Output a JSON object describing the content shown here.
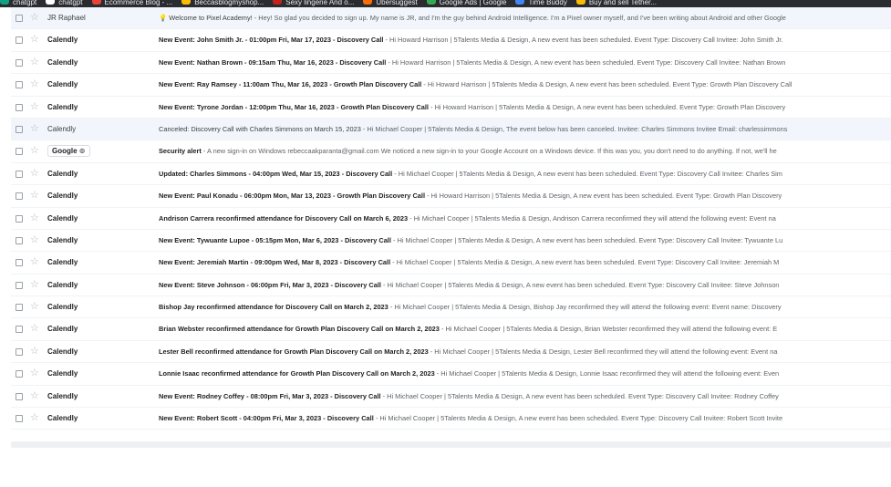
{
  "bookmarks": [
    {
      "label": "chatgpt",
      "icon": "chatgpt-icon",
      "color": "#10a37f"
    },
    {
      "label": "chatgpt",
      "icon": "chatgpt-icon",
      "color": "#ffffff"
    },
    {
      "label": "Ecommerce Blog - ...",
      "icon": "ecommerce-icon",
      "color": "#ea4335"
    },
    {
      "label": "Beccasblogmyshop...",
      "icon": "blog-icon",
      "color": "#fbbc04"
    },
    {
      "label": "Sexy lingerie And o...",
      "icon": "lingerie-icon",
      "color": "#c5221f"
    },
    {
      "label": "Ubersuggest",
      "icon": "ubersuggest-icon",
      "color": "#ff6d00"
    },
    {
      "label": "Google Ads | Google",
      "icon": "google-ads-icon",
      "color": "#34a853"
    },
    {
      "label": "Time Buddy",
      "icon": "time-buddy-icon",
      "color": "#4285f4"
    },
    {
      "label": "Buy and sell Tether...",
      "icon": "tether-icon",
      "color": "#fbbc04"
    }
  ],
  "emails": [
    {
      "sender": "JR Raphael",
      "subject": "💡 Welcome to Pixel Academy!",
      "snippet": " - Hey! So glad you decided to sign up. My name is JR, and I'm the guy behind Android Intelligence. I'm a Pixel owner myself, and I've been writing about Android and other Google",
      "read": true
    },
    {
      "sender": "Calendly",
      "subject": "New Event: John Smith Jr. - 01:00pm Fri, Mar 17, 2023 - Discovery Call",
      "snippet": " - Hi Howard Harrison | 5Talents Media & Design, A new event has been scheduled. Event Type: Discovery Call Invitee: John Smith Jr.",
      "read": false
    },
    {
      "sender": "Calendly",
      "subject": "New Event: Nathan Brown - 09:15am Thu, Mar 16, 2023 - Discovery Call",
      "snippet": " - Hi Howard Harrison | 5Talents Media & Design, A new event has been scheduled. Event Type: Discovery Call Invitee: Nathan Brown",
      "read": false
    },
    {
      "sender": "Calendly",
      "subject": "New Event: Ray Ramsey - 11:00am Thu, Mar 16, 2023 - Growth Plan Discovery Call",
      "snippet": " - Hi Howard Harrison | 5Talents Media & Design, A new event has been scheduled. Event Type: Growth Plan Discovery Call",
      "read": false
    },
    {
      "sender": "Calendly",
      "subject": "New Event: Tyrone Jordan - 12:00pm Thu, Mar 16, 2023 - Growth Plan Discovery Call",
      "snippet": " - Hi Howard Harrison | 5Talents Media & Design, A new event has been scheduled. Event Type: Growth Plan Discovery",
      "read": false
    },
    {
      "sender": "Calendly",
      "subject": "Canceled: Discovery Call with Charles Simmons on March 15, 2023",
      "snippet": " - Hi Michael Cooper | 5Talents Media & Design, The event below has been canceled. Invitee: Charles Simmons Invitee Email: charlessimmons",
      "read": true
    },
    {
      "sender": "Google",
      "chip": "Google",
      "subject": "Security alert",
      "snippet": " - A new sign-in on Windows rebeccaakparanta@gmail.com We noticed a new sign-in to your Google Account on a Windows device. If this was you, you don't need to do anything. If not, we'll he",
      "read": false
    },
    {
      "sender": "Calendly",
      "subject": "Updated: Charles Simmons - 04:00pm Wed, Mar 15, 2023 - Discovery Call",
      "snippet": " - Hi Michael Cooper | 5Talents Media & Design, A new event has been scheduled. Event Type: Discovery Call Invitee: Charles Sim",
      "read": false
    },
    {
      "sender": "Calendly",
      "subject": "New Event: Paul Konadu - 06:00pm Mon, Mar 13, 2023 - Growth Plan Discovery Call",
      "snippet": " - Hi Howard Harrison | 5Talents Media & Design, A new event has been scheduled. Event Type: Growth Plan Discovery",
      "read": false
    },
    {
      "sender": "Calendly",
      "subject": "Andrison Carrera reconfirmed attendance for Discovery Call on March 6, 2023",
      "snippet": " - Hi Michael Cooper | 5Talents Media & Design, Andrison Carrera reconfirmed they will attend the following event: Event na",
      "read": false
    },
    {
      "sender": "Calendly",
      "subject": "New Event: Tywuante Lupoe - 05:15pm Mon, Mar 6, 2023 - Discovery Call",
      "snippet": " - Hi Michael Cooper | 5Talents Media & Design, A new event has been scheduled. Event Type: Discovery Call Invitee: Tywuante Lu",
      "read": false
    },
    {
      "sender": "Calendly",
      "subject": "New Event: Jeremiah Martin - 09:00pm Wed, Mar 8, 2023 - Discovery Call",
      "snippet": " - Hi Michael Cooper | 5Talents Media & Design, A new event has been scheduled. Event Type: Discovery Call Invitee: Jeremiah M",
      "read": false
    },
    {
      "sender": "Calendly",
      "subject": "New Event: Steve Johnson - 06:00pm Fri, Mar 3, 2023 - Discovery Call",
      "snippet": " - Hi Michael Cooper | 5Talents Media & Design, A new event has been scheduled. Event Type: Discovery Call Invitee: Steve Johnson",
      "read": false
    },
    {
      "sender": "Calendly",
      "subject": "Bishop Jay reconfirmed attendance for Discovery Call on March 2, 2023",
      "snippet": " - Hi Michael Cooper | 5Talents Media & Design, Bishop Jay reconfirmed they will attend the following event: Event name: Discovery",
      "read": false
    },
    {
      "sender": "Calendly",
      "subject": "Brian Webster reconfirmed attendance for Growth Plan Discovery Call on March 2, 2023",
      "snippet": " - Hi Michael Cooper | 5Talents Media & Design, Brian Webster reconfirmed they will attend the following event: E",
      "read": false
    },
    {
      "sender": "Calendly",
      "subject": "Lester Bell reconfirmed attendance for Growth Plan Discovery Call on March 2, 2023",
      "snippet": " - Hi Michael Cooper | 5Talents Media & Design, Lester Bell reconfirmed they will attend the following event: Event na",
      "read": false
    },
    {
      "sender": "Calendly",
      "subject": "Lonnie Isaac reconfirmed attendance for Growth Plan Discovery Call on March 2, 2023",
      "snippet": " - Hi Michael Cooper | 5Talents Media & Design, Lonnie Isaac reconfirmed they will attend the following event: Even",
      "read": false
    },
    {
      "sender": "Calendly",
      "subject": "New Event: Rodney Coffey - 08:00pm Fri, Mar 3, 2023 - Discovery Call",
      "snippet": " - Hi Michael Cooper | 5Talents Media & Design, A new event has been scheduled. Event Type: Discovery Call Invitee: Rodney Coffey",
      "read": false
    },
    {
      "sender": "Calendly",
      "subject": "New Event: Robert Scott - 04:00pm Fri, Mar 3, 2023 - Discovery Call",
      "snippet": " - Hi Michael Cooper | 5Talents Media & Design, A new event has been scheduled. Event Type: Discovery Call Invitee: Robert Scott Invite",
      "read": false
    }
  ]
}
